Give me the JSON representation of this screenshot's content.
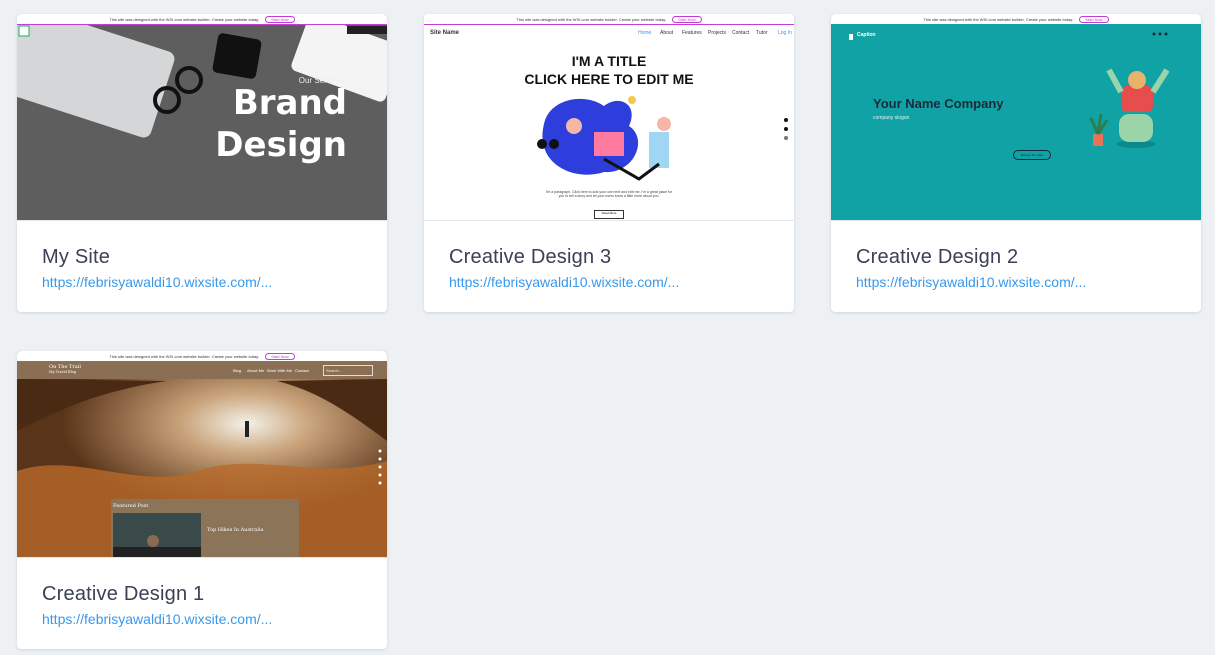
{
  "sites": [
    {
      "name": "My Site",
      "url": "https://febrisyawaldi10.wixsite.com/...",
      "thumb": {
        "services": "Our Services",
        "brand1": "Brand",
        "brand2": "Design"
      }
    },
    {
      "name": "Creative Design 3",
      "url": "https://febrisyawaldi10.wixsite.com/...",
      "thumb": {
        "site_name": "Site Name",
        "title1": "I'M A TITLE",
        "title2": "CLICK HERE TO EDIT ME",
        "nav": [
          "Home",
          "About",
          "Features",
          "Projects",
          "Contact",
          "Tutor"
        ],
        "login": "Log In",
        "para": "I'm a paragraph. Click here to add your own text and edit me. I'm a great place for you to tell a story and let your users know a little more about you.",
        "readmore": "Read More"
      }
    },
    {
      "name": "Creative Design 2",
      "url": "https://febrisyawaldi10.wixsite.com/...",
      "thumb": {
        "caption": "Caption",
        "company": "Your Name Company",
        "slogan": "company slogan",
        "button": "Browse the Spot"
      }
    },
    {
      "name": "Creative Design 1",
      "url": "https://febrisyawaldi10.wixsite.com/...",
      "thumb": {
        "logo1": "On The Trail",
        "logo2": "My Travel Blog",
        "nav": [
          "Blog",
          "About Me",
          "Work With Me",
          "Contact"
        ],
        "search": "Search...",
        "featured": "Featured Post",
        "post_title": "Top Hikes In Australia"
      }
    }
  ],
  "wix_banner": {
    "text": "This site was designed with the WIX.com website builder. Create your website today.",
    "button": "Start Now"
  },
  "colors": {
    "accent": "#3899ec",
    "title": "#3b4057",
    "background": "#eef1f4",
    "teal": "#10a2a4"
  }
}
